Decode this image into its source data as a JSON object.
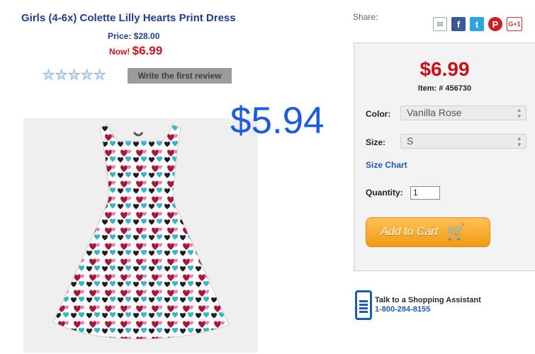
{
  "product": {
    "title": "Girls (4-6x) Colette Lilly Hearts Print Dress",
    "price_label": "Price: $28.00",
    "now_label": "Now!",
    "now_price": "$6.99",
    "rating_stars": 0,
    "review_button": "Write the first review",
    "overlay_price": "$5.94"
  },
  "share": {
    "label": "Share:",
    "icons": [
      "mail-icon",
      "facebook-icon",
      "twitter-icon",
      "pinterest-icon",
      "google-plus-icon"
    ],
    "gplus_text": "G+1"
  },
  "buybox": {
    "price": "$6.99",
    "item": "Item: # 456730",
    "color_label": "Color:",
    "color_value": "Vanilla Rose",
    "size_label": "Size:",
    "size_value": "S",
    "size_chart": "Size Chart",
    "quantity_label": "Quantity:",
    "quantity_value": "1",
    "add_to_cart": "Add to Cart"
  },
  "assistant": {
    "line1": "Talk to a Shopping Assistant",
    "line2": "1-800-284-8155"
  },
  "colors": {
    "title_blue": "#1f3f8e",
    "price_red": "#c8101b",
    "overlay_blue": "#1a5be0",
    "cart_orange": "#f29a12"
  }
}
